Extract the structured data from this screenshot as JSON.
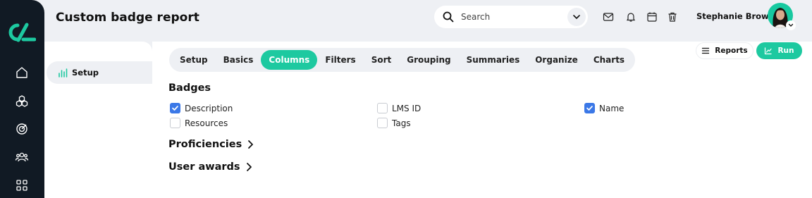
{
  "colors": {
    "rail": "#111a24",
    "accent": "#1dc9a0",
    "checkbox_checked": "#3b78e7"
  },
  "rail": {
    "icons": [
      "logo-icon",
      "home-icon",
      "cubes-icon",
      "target-icon",
      "users-icon",
      "apps-grid-icon"
    ]
  },
  "header": {
    "title": "Custom badge report",
    "search_placeholder": "Search",
    "icons": [
      "mail-icon",
      "bell-icon",
      "calendar-icon",
      "trash-icon"
    ],
    "user_name": "Stephanie Brown"
  },
  "sidebar": {
    "items": [
      {
        "label": "Setup",
        "icon": "bar-chart-icon",
        "active": true
      }
    ]
  },
  "tabs": [
    {
      "label": "Setup",
      "active": false
    },
    {
      "label": "Basics",
      "active": false
    },
    {
      "label": "Columns",
      "active": true
    },
    {
      "label": "Filters",
      "active": false
    },
    {
      "label": "Sort",
      "active": false
    },
    {
      "label": "Grouping",
      "active": false
    },
    {
      "label": "Summaries",
      "active": false
    },
    {
      "label": "Organize",
      "active": false
    },
    {
      "label": "Charts",
      "active": false
    }
  ],
  "actions": {
    "reports_label": "Reports",
    "run_label": "Run"
  },
  "sections": {
    "badges": {
      "title": "Badges",
      "fields": [
        {
          "label": "Description",
          "checked": true
        },
        {
          "label": "LMS ID",
          "checked": false
        },
        {
          "label": "Name",
          "checked": true
        },
        {
          "label": "Resources",
          "checked": false
        },
        {
          "label": "Tags",
          "checked": false
        }
      ]
    },
    "proficiencies": {
      "title": "Proficiencies"
    },
    "user_awards": {
      "title": "User awards"
    }
  }
}
